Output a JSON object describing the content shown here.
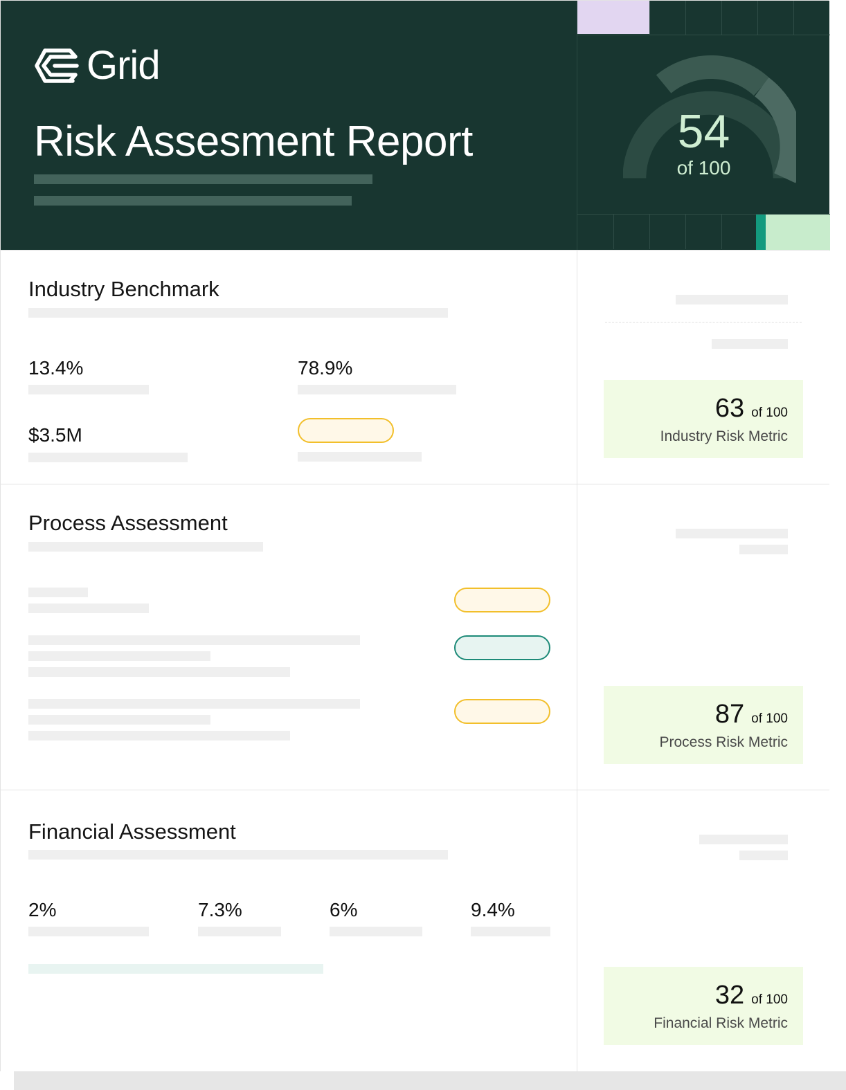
{
  "brand": {
    "name": "Grid",
    "logo_icon": "grid-logo-icon"
  },
  "report": {
    "title": "Risk Assesment Report"
  },
  "overall": {
    "score": "54",
    "of": "of 100",
    "score_value": 54,
    "max": 100
  },
  "colors": {
    "header_bg": "#183630",
    "accent_lavender": "#e2d6f1",
    "accent_teal": "#139a7e",
    "accent_mint": "#c8eccc",
    "metric_card_bg": "#f1fbe4",
    "pill_amber": "#f2bf2b",
    "pill_teal": "#1d8a78"
  },
  "sections": {
    "industry": {
      "title": "Industry Benchmark",
      "stats": [
        "13.4%",
        "78.9%",
        "$3.5M"
      ],
      "metric": {
        "score": "63",
        "of": "of 100",
        "label": "Industry Risk Metric"
      }
    },
    "process": {
      "title": "Process Assessment",
      "metric": {
        "score": "87",
        "of": "of 100",
        "label": "Process Risk Metric"
      }
    },
    "financial": {
      "title": "Financial Assessment",
      "stats": [
        "2%",
        "7.3%",
        "6%",
        "9.4%"
      ],
      "metric": {
        "score": "32",
        "of": "of 100",
        "label": "Financial Risk Metric"
      }
    }
  }
}
